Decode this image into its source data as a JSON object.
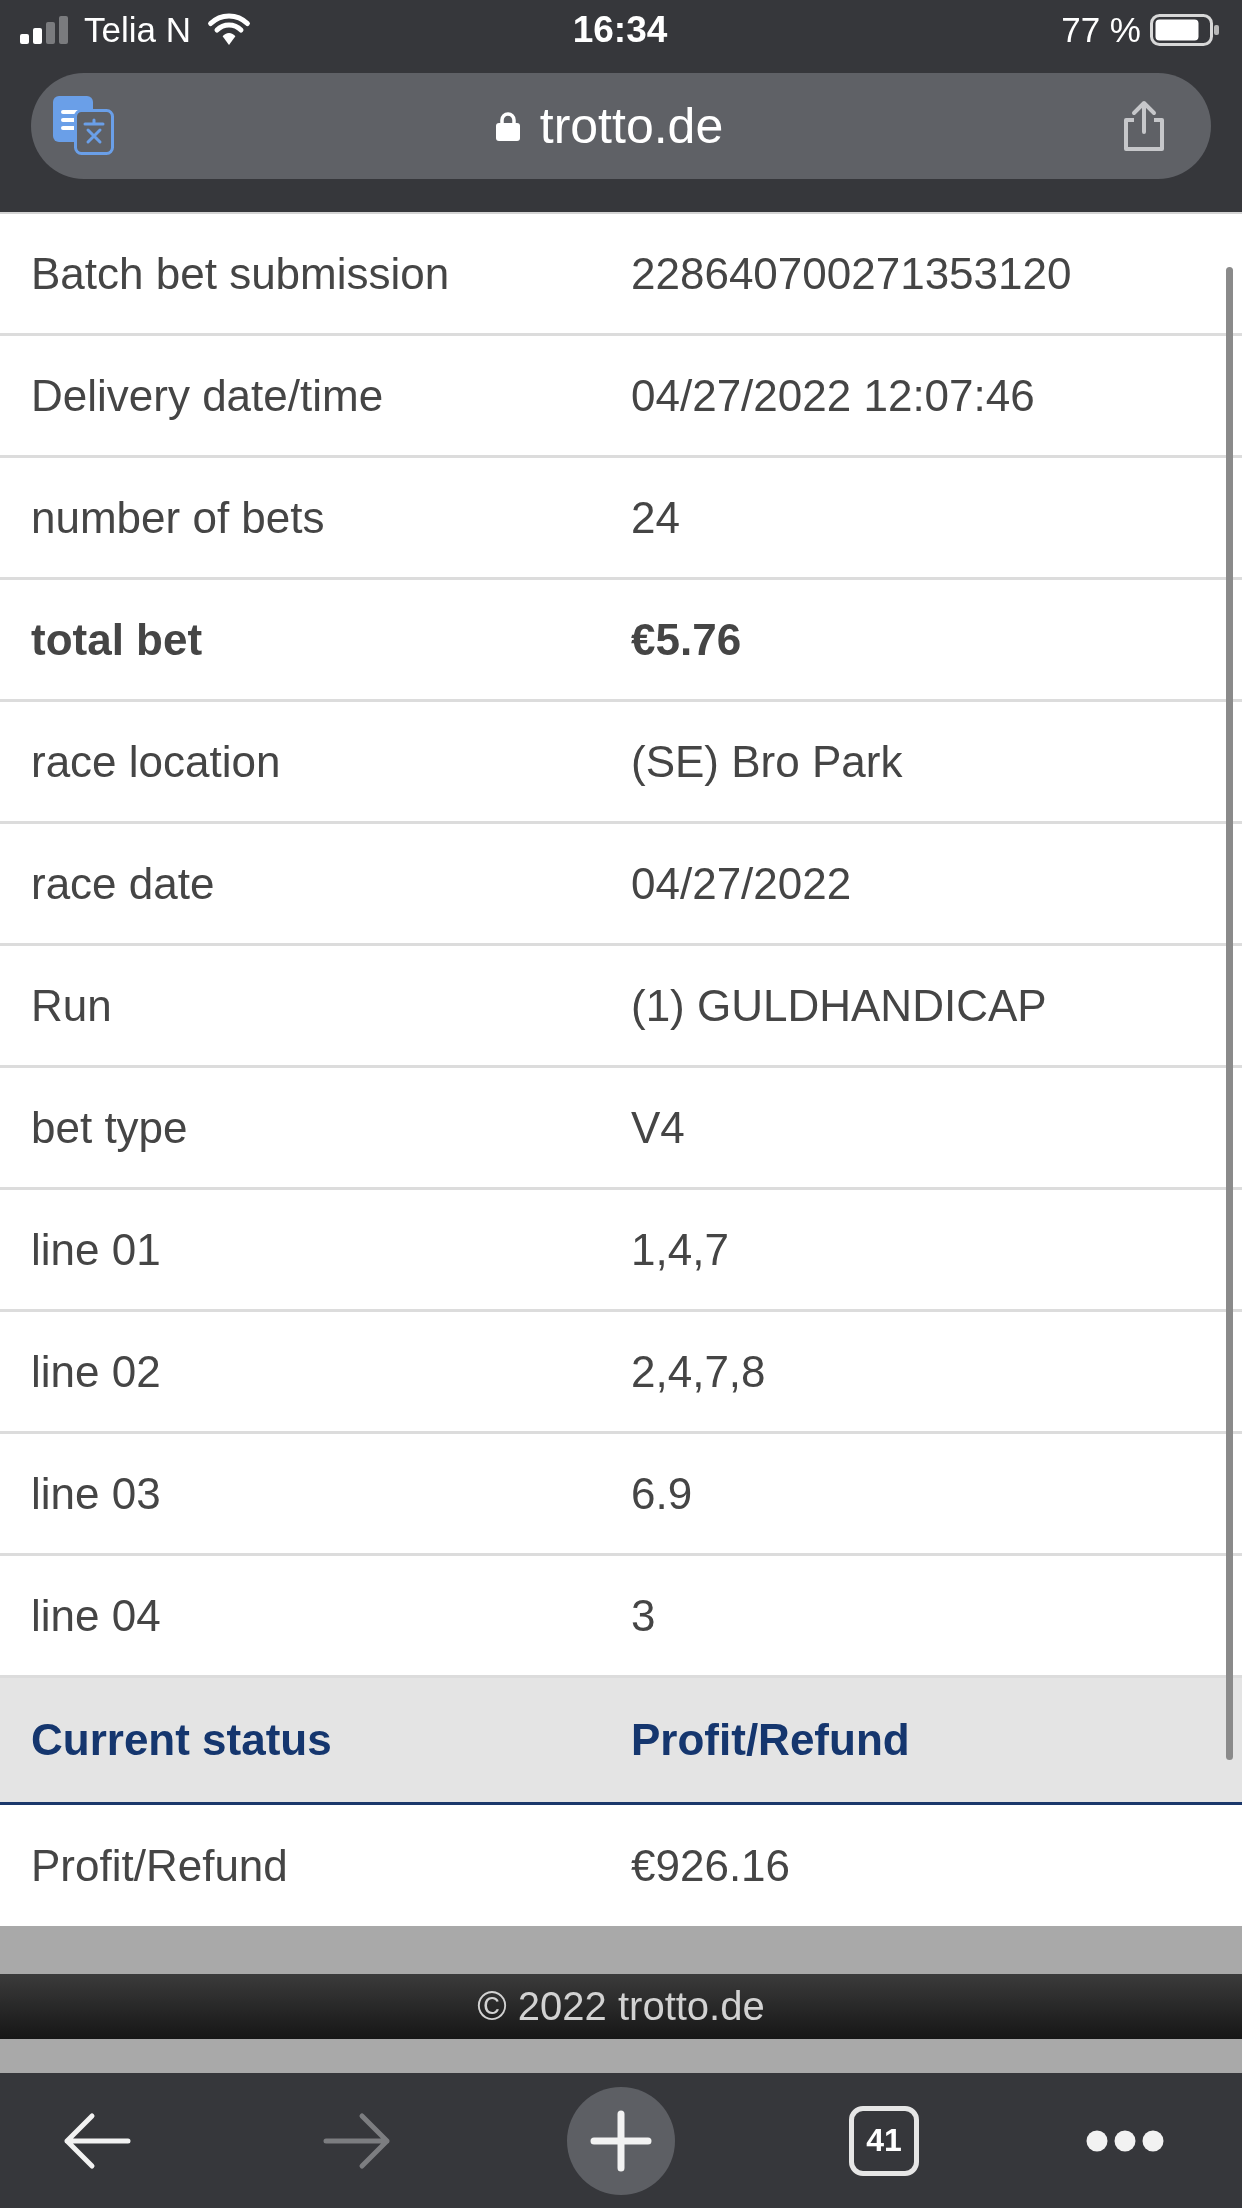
{
  "status_bar": {
    "carrier": "Telia N",
    "time": "16:34",
    "battery": "77 %"
  },
  "address_bar": {
    "url": "trotto.de"
  },
  "details": [
    {
      "label": "Batch bet submission",
      "value": "228640700271353120",
      "emphasized": false
    },
    {
      "label": "Delivery date/time",
      "value": "04/27/2022 12:07:46",
      "emphasized": false
    },
    {
      "label": "number of bets",
      "value": "24",
      "emphasized": false
    },
    {
      "label": "total bet",
      "value": "€5.76",
      "emphasized": true
    },
    {
      "label": "race location",
      "value": "(SE) Bro Park",
      "emphasized": false
    },
    {
      "label": "race date",
      "value": "04/27/2022",
      "emphasized": false
    },
    {
      "label": "Run",
      "value": "(1) GULDHANDICAP",
      "emphasized": false
    },
    {
      "label": "bet type",
      "value": "V4",
      "emphasized": false
    },
    {
      "label": "line 01",
      "value": "1,4,7",
      "emphasized": false
    },
    {
      "label": "line 02",
      "value": "2,4,7,8",
      "emphasized": false
    },
    {
      "label": "line 03",
      "value": "6.9",
      "emphasized": false
    },
    {
      "label": "line 04",
      "value": "3",
      "emphasized": false
    }
  ],
  "status_table": {
    "columns": [
      "Current status",
      "Profit/Refund"
    ],
    "rows": [
      {
        "label": "Profit/Refund",
        "value": "€926.16"
      }
    ]
  },
  "footer": {
    "text": "© 2022 trotto.de"
  },
  "toolbar": {
    "back": {
      "disabled": false
    },
    "forward": {
      "disabled": true
    },
    "tab_count": "41"
  }
}
